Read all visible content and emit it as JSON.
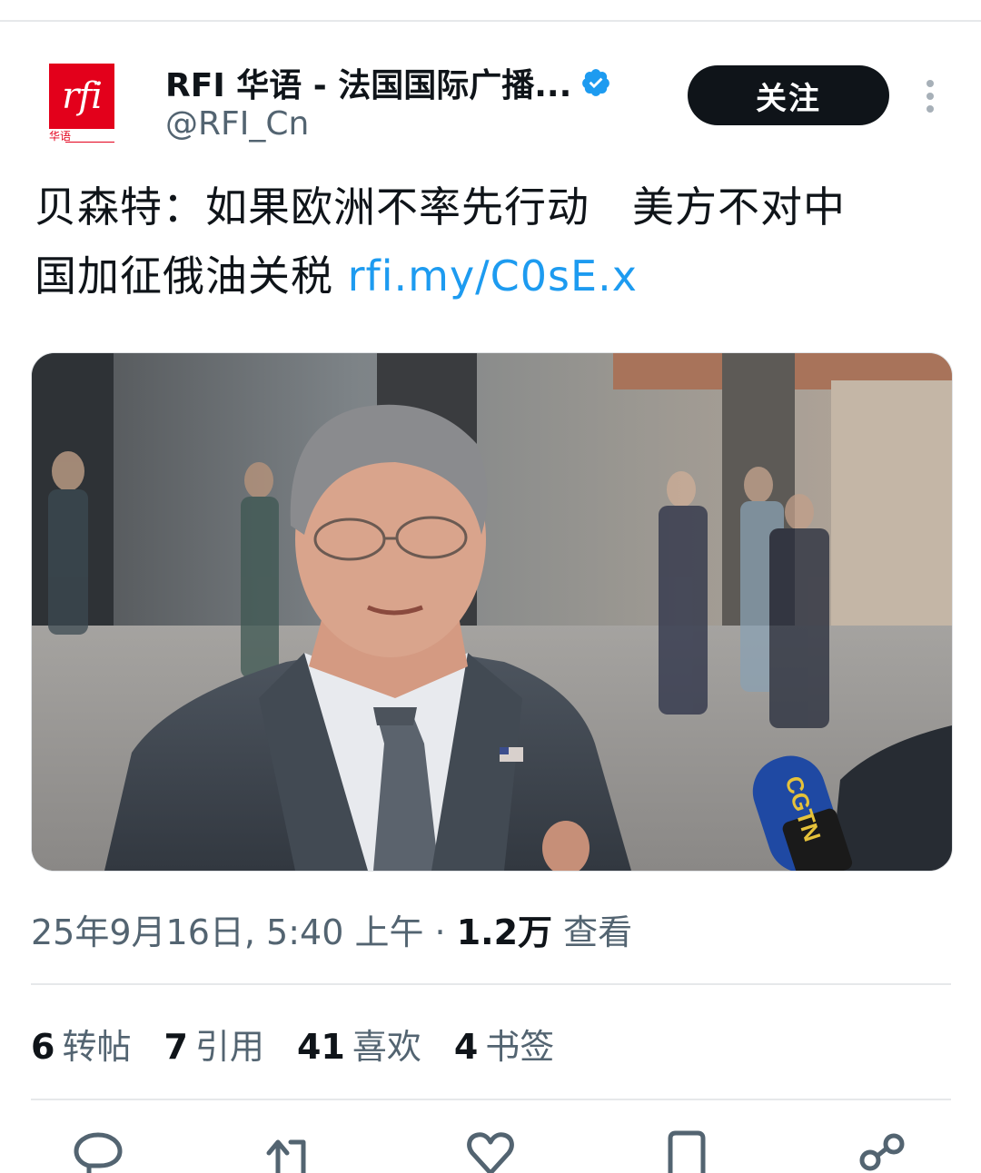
{
  "author": {
    "avatar_logo_text": "rfi",
    "avatar_sub_text": "华语",
    "display_name": "RFI 华语 - 法国国际广播...",
    "handle": "@RFI_Cn",
    "verified_icon": "verified-badge-icon"
  },
  "header": {
    "follow_label": "关注",
    "more_icon": "more-vertical-icon"
  },
  "tweet": {
    "text_line1": "贝森特：如果欧洲不率先行动　美方不对中",
    "text_line2": "国加征俄油关税 ",
    "link": "rfi.my/C0sE.x"
  },
  "media": {
    "description_icon": "photo-man-speaking-microphone",
    "mic_label": "CGTN"
  },
  "meta": {
    "date": "25年9月16日, 5:40 上午 · ",
    "views_count": "1.2万",
    "views_label": " 查看"
  },
  "stats": [
    {
      "num": "6",
      "label": "转帖"
    },
    {
      "num": "7",
      "label": "引用"
    },
    {
      "num": "41",
      "label": "喜欢"
    },
    {
      "num": "4",
      "label": "书签"
    }
  ],
  "actions": [
    "reply-icon",
    "retweet-icon",
    "like-icon",
    "bookmark-icon",
    "share-icon"
  ],
  "colors": {
    "link": "#1d9bf0",
    "verified": "#1d9bf0",
    "brand_red": "#e3001b",
    "button_dark": "#0f1419",
    "secondary_text": "#536471"
  }
}
